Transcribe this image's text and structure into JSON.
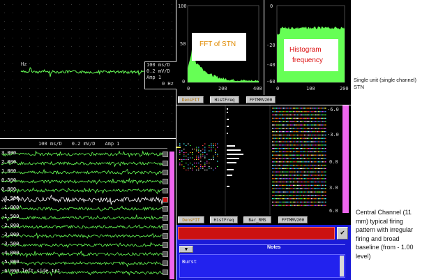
{
  "colors": {
    "trace": "#66ff55",
    "highlight_trace": "#ffffff",
    "pink_scroll": "#ee66ee",
    "notes_blue": "#1a1ad8",
    "record_red": "#cc1111"
  },
  "top_left": {
    "label_hz": "Hz",
    "settings": [
      "100 ms/D",
      "0.2 mV/D",
      "Amp 1",
      "0 Hz"
    ]
  },
  "fft_panel": {
    "y_ticks": [
      "100",
      "50",
      "0"
    ],
    "x_ticks": [
      "0",
      "200",
      "400"
    ],
    "callout": "FFT of STN"
  },
  "histogram_panel": {
    "y_ticks": [
      "0",
      "-20",
      "-40",
      "-60"
    ],
    "x_ticks": [
      "0",
      "100",
      "200"
    ],
    "callout_line1": "Histogram",
    "callout_line2": "frequency"
  },
  "tabs_top": [
    "DensFIT",
    "HistFreq",
    "FFTMRV200"
  ],
  "multi_header": [
    "100 ms/D",
    "0.2 mV/D",
    "Amp 1"
  ],
  "channel_labels": [
    "3.000",
    "2.000",
    "1.000",
    "0.500",
    "0.000",
    "-0.500",
    "-1.000",
    "-1.500",
    "-2.000",
    "-3.000",
    "-3.500",
    "-4.000",
    "-5.000",
    "-6.000"
  ],
  "last_channel_suffix": "left side tr1",
  "right_scale": [
    "-6.0",
    "-3.0",
    "0.0",
    "3.0",
    "6.0"
  ],
  "tabs_bottom": [
    "DensFIT",
    "HistFreq",
    "Bar_RMS",
    "FFTMRV200"
  ],
  "notes": {
    "title": "Notes",
    "dropdown_glyph": "▼",
    "entry": "Burst"
  },
  "annotations": {
    "top_right": "Single unit (single channel) STN",
    "bottom_right": "Central Channel (11 mm) typical firing pattern with irregular firing and broad baseline (from - 1.00 level)"
  },
  "icons": {
    "record_button": "red-square",
    "check_button": "check-icon"
  }
}
